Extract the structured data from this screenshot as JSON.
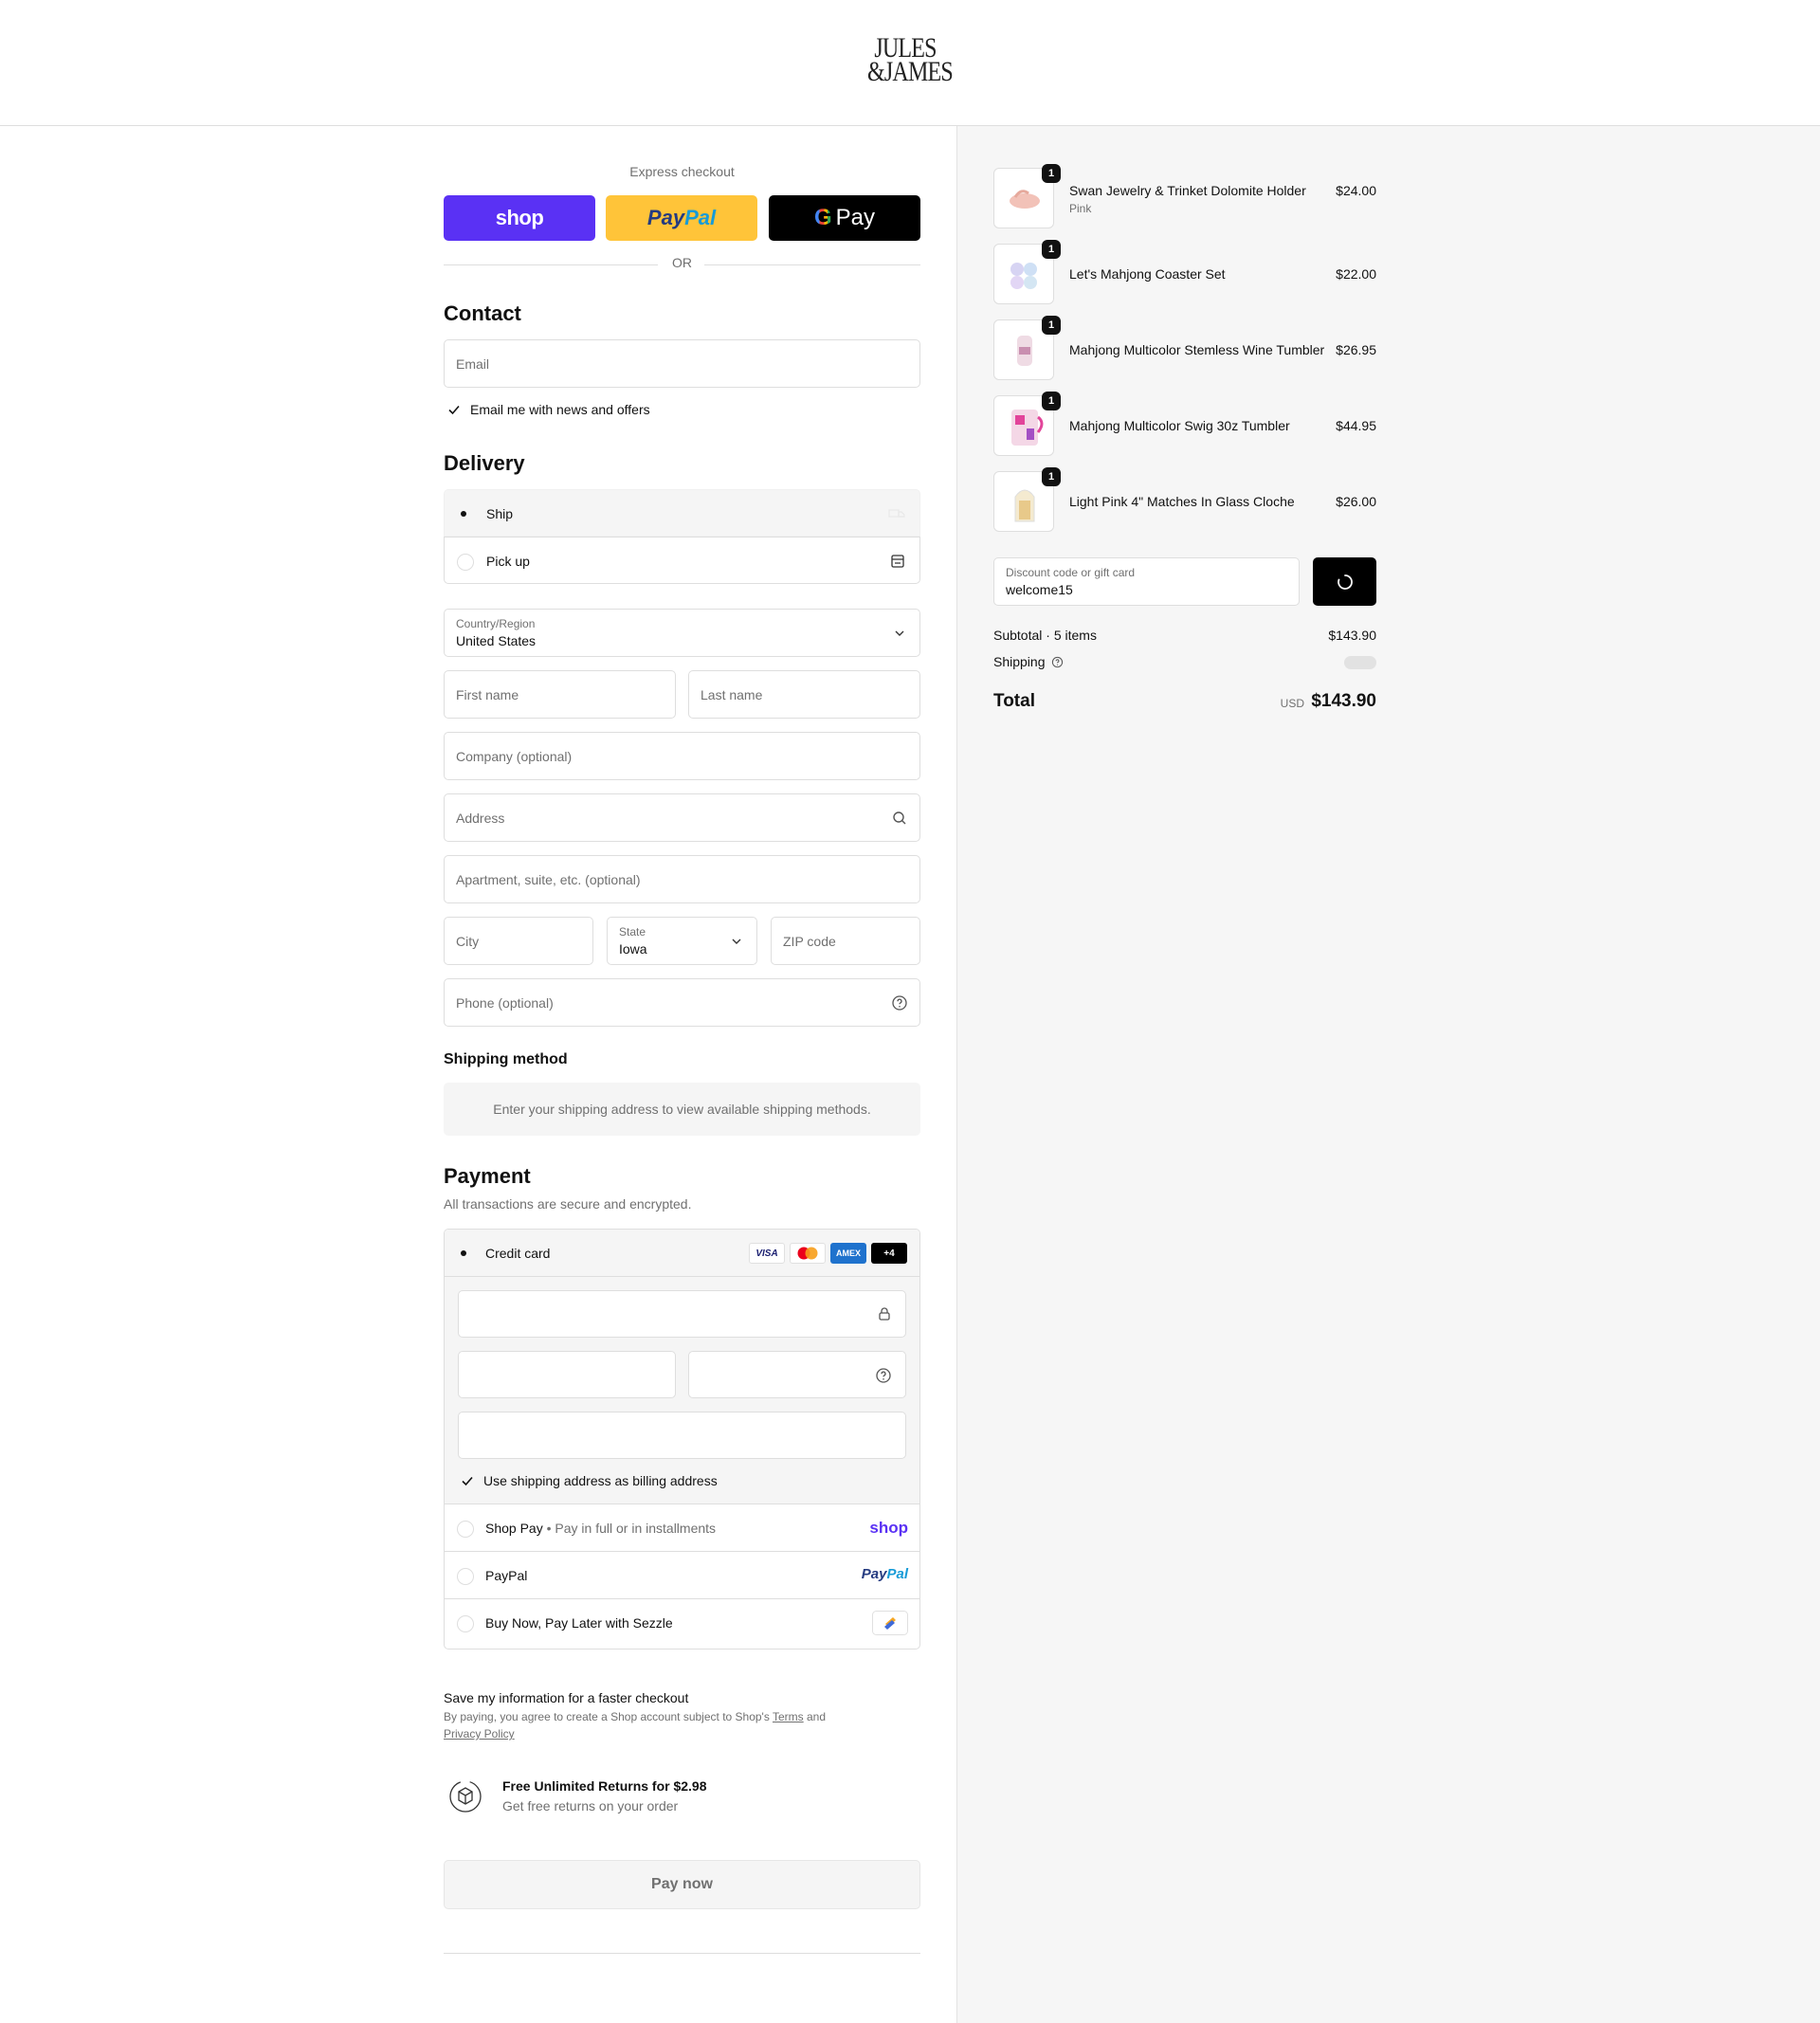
{
  "brand": {
    "logo_line1": "JULES",
    "logo_line2": "&JAMES"
  },
  "express": {
    "label": "Express checkout",
    "shop_label": "shop",
    "paypal_part1": "Pay",
    "paypal_part2": "Pal",
    "gpay_g": "G",
    "gpay_label": "Pay",
    "or_label": "OR"
  },
  "contact": {
    "title": "Contact",
    "email_placeholder": "Email",
    "newsletter_label": "Email me with news and offers"
  },
  "delivery": {
    "title": "Delivery",
    "options": [
      {
        "label": "Ship",
        "selected": true
      },
      {
        "label": "Pick up",
        "selected": false
      }
    ],
    "country_label": "Country/Region",
    "country_value": "United States",
    "first_name_placeholder": "First name",
    "last_name_placeholder": "Last name",
    "company_placeholder": "Company (optional)",
    "address_placeholder": "Address",
    "apartment_placeholder": "Apartment, suite, etc. (optional)",
    "city_placeholder": "City",
    "state_label": "State",
    "state_value": "Iowa",
    "zip_placeholder": "ZIP code",
    "phone_placeholder": "Phone (optional)"
  },
  "shipping_method": {
    "title": "Shipping method",
    "message": "Enter your shipping address to view available shipping methods."
  },
  "payment": {
    "title": "Payment",
    "subtitle": "All transactions are secure and encrypted.",
    "credit_card_label": "Credit card",
    "card_brands": [
      "VISA",
      "Mastercard",
      "AMEX",
      "+4"
    ],
    "visa_label": "VISA",
    "amex_label": "AMEX",
    "more_brands_label": "+4",
    "billing_same_label": "Use shipping address as billing address",
    "shop_pay_label": "Shop Pay",
    "shop_pay_note": "Pay in full or in installments",
    "shop_pay_logo": "shop",
    "paypal_label": "PayPal",
    "paypal_logo_1": "Pay",
    "paypal_logo_2": "Pal",
    "sezzle_label": "Buy Now, Pay Later with Sezzle"
  },
  "save_info": {
    "title": "Save my information for a faster checkout",
    "text_before": "By paying, you agree to create a Shop account subject to Shop's",
    "terms_link": "Terms",
    "and": "and",
    "privacy_link": "Privacy Policy"
  },
  "returns": {
    "title": "Free Unlimited Returns for $2.98",
    "subtitle": "Get free returns on your order"
  },
  "pay_now_label": "Pay now",
  "order": {
    "items": [
      {
        "name": "Swan Jewelry & Trinket Dolomite Holder",
        "variant": "Pink",
        "price": "$24.00",
        "qty": "1"
      },
      {
        "name": "Let's Mahjong Coaster Set",
        "variant": "",
        "price": "$22.00",
        "qty": "1"
      },
      {
        "name": "Mahjong Multicolor Stemless Wine Tumbler",
        "variant": "",
        "price": "$26.95",
        "qty": "1"
      },
      {
        "name": "Mahjong Multicolor Swig 30z Tumbler",
        "variant": "",
        "price": "$44.95",
        "qty": "1"
      },
      {
        "name": "Light Pink 4\" Matches In Glass Cloche",
        "variant": "",
        "price": "$26.00",
        "qty": "1"
      }
    ],
    "discount_label": "Discount code or gift card",
    "discount_value": "welcome15",
    "subtotal_label": "Subtotal · 5 items",
    "subtotal_value": "$143.90",
    "shipping_label": "Shipping",
    "total_label": "Total",
    "currency": "USD",
    "total_value": "$143.90"
  },
  "colors": {
    "shop_purple": "#5a31f4",
    "paypal_yellow": "#ffc439",
    "paypal_dark": "#253b80",
    "paypal_light": "#179bd7",
    "summary_bg": "#f6f6f6"
  }
}
